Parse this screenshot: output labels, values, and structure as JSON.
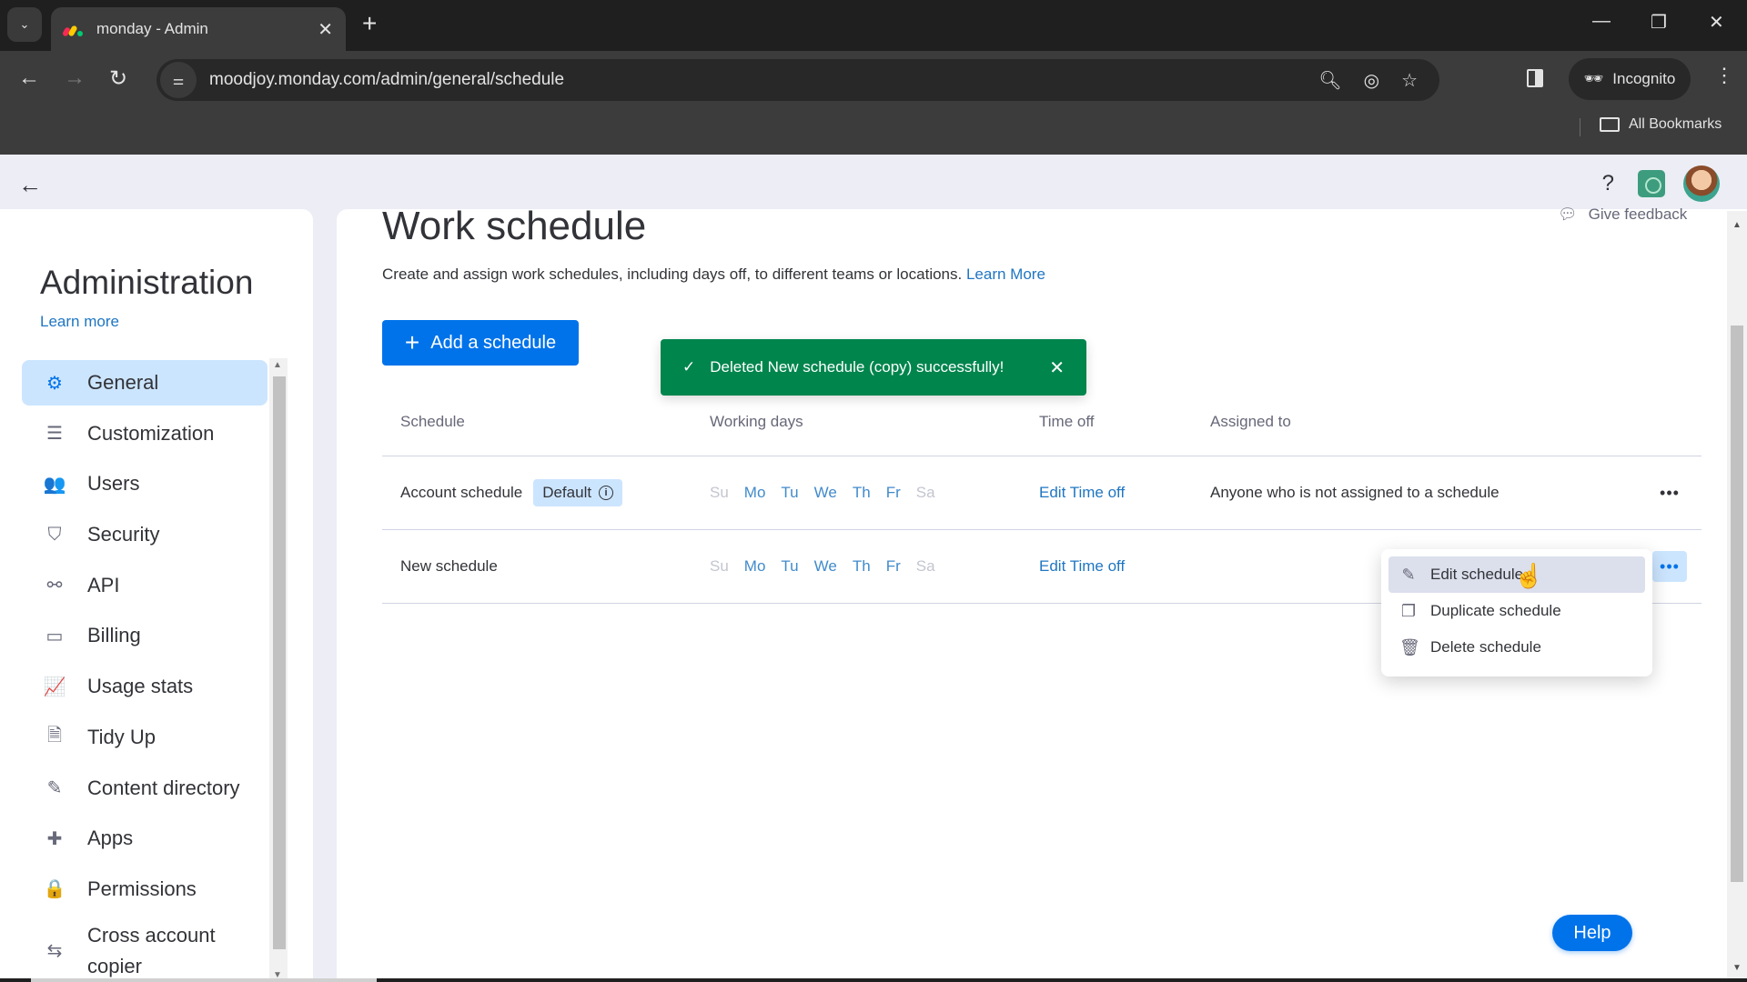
{
  "browser": {
    "tab_title": "monday - Admin",
    "url": "moodjoy.monday.com/admin/general/schedule",
    "incognito_label": "Incognito",
    "all_bookmarks_label": "All Bookmarks",
    "tab_close_glyph": "✕",
    "new_tab_glyph": "+",
    "menu_glyph": "⌄"
  },
  "header": {
    "help_glyph": "?"
  },
  "sidebar": {
    "title": "Administration",
    "learn_more": "Learn more",
    "items": [
      {
        "label": "General",
        "icon": "gear-icon",
        "glyph": "⚙",
        "active": true
      },
      {
        "label": "Customization",
        "icon": "sliders-icon",
        "glyph": "☰"
      },
      {
        "label": "Users",
        "icon": "users-icon",
        "glyph": "👥"
      },
      {
        "label": "Security",
        "icon": "shield-icon",
        "glyph": "⛉"
      },
      {
        "label": "API",
        "icon": "api-icon",
        "glyph": "⚯"
      },
      {
        "label": "Billing",
        "icon": "credit-card-icon",
        "glyph": "▭"
      },
      {
        "label": "Usage stats",
        "icon": "chart-icon",
        "glyph": "📈"
      },
      {
        "label": "Tidy Up",
        "icon": "shredder-icon",
        "glyph": "🗎"
      },
      {
        "label": "Content directory",
        "icon": "content-directory-icon",
        "glyph": "✎"
      },
      {
        "label": "Apps",
        "icon": "puzzle-icon",
        "glyph": "✚"
      },
      {
        "label": "Permissions",
        "icon": "lock-icon",
        "glyph": "🔒"
      },
      {
        "label": "Cross account copier",
        "icon": "swap-arrows-icon",
        "glyph": "⇆"
      }
    ]
  },
  "main": {
    "title": "Work schedule",
    "give_feedback": "Give feedback",
    "description": "Create and assign work schedules, including days off, to different teams or locations.",
    "description_link": "Learn More",
    "add_button": "Add a schedule",
    "table": {
      "headers": [
        "Schedule",
        "Working days",
        "Time off",
        "Assigned to"
      ],
      "rows": [
        {
          "name": "Account schedule",
          "badge": "Default",
          "days": [
            {
              "d": "Su",
              "on": false
            },
            {
              "d": "Mo",
              "on": true
            },
            {
              "d": "Tu",
              "on": true
            },
            {
              "d": "We",
              "on": true
            },
            {
              "d": "Th",
              "on": true
            },
            {
              "d": "Fr",
              "on": true
            },
            {
              "d": "Sa",
              "on": false
            }
          ],
          "time_off": "Edit Time off",
          "assigned_to": "Anyone who is not assigned to a schedule",
          "more": "•••"
        },
        {
          "name": "New schedule",
          "days": [
            {
              "d": "Su",
              "on": false
            },
            {
              "d": "Mo",
              "on": true
            },
            {
              "d": "Tu",
              "on": true
            },
            {
              "d": "We",
              "on": true
            },
            {
              "d": "Th",
              "on": true
            },
            {
              "d": "Fr",
              "on": true
            },
            {
              "d": "Sa",
              "on": false
            }
          ],
          "time_off": "Edit Time off",
          "assigned_to": "",
          "more": "•••"
        }
      ]
    }
  },
  "context_menu": {
    "items": [
      {
        "label": "Edit schedule",
        "icon": "pencil-icon",
        "glyph": "✎"
      },
      {
        "label": "Duplicate schedule",
        "icon": "duplicate-icon",
        "glyph": "❐"
      },
      {
        "label": "Delete schedule",
        "icon": "trash-icon",
        "glyph": "🗑"
      }
    ]
  },
  "toast": {
    "message": "Deleted New schedule (copy) successfully!",
    "check_glyph": "✓",
    "close_glyph": "✕",
    "color": "#00854d"
  },
  "help_button": "Help",
  "colors": {
    "primary": "#0073ea",
    "link": "#1f76c2",
    "active_bg": "#cce5ff",
    "success": "#00854d"
  }
}
